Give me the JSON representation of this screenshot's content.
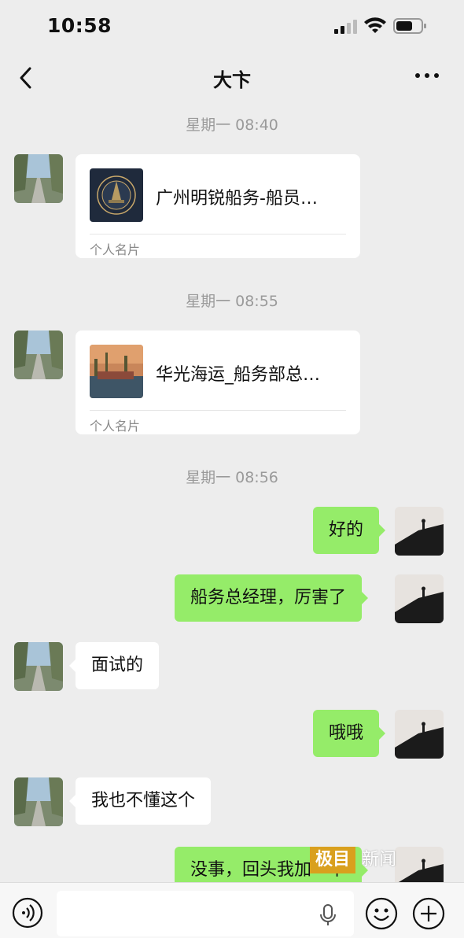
{
  "status_bar": {
    "time": "10:58"
  },
  "chat": {
    "title": "大卞"
  },
  "messages": [
    {
      "type": "time",
      "text": "星期一 08:40"
    },
    {
      "type": "card",
      "side": "left",
      "name": "广州明锐船务-船员…",
      "sub": "个人名片"
    },
    {
      "type": "time",
      "text": "星期一 08:55"
    },
    {
      "type": "card",
      "side": "left",
      "name": "华光海运_船务部总…",
      "sub": "个人名片"
    },
    {
      "type": "time",
      "text": "星期一 08:56"
    },
    {
      "type": "text",
      "side": "right",
      "text": "好的"
    },
    {
      "type": "text",
      "side": "right",
      "text": "船务总经理，厉害了"
    },
    {
      "type": "text",
      "side": "left",
      "text": "面试的"
    },
    {
      "type": "text",
      "side": "right",
      "text": "哦哦"
    },
    {
      "type": "text",
      "side": "left",
      "text": "我也不懂这个"
    },
    {
      "type": "text",
      "side": "right",
      "text": "没事，回头我加一下"
    }
  ],
  "watermark": {
    "part1": "极目",
    "part2": "新闻"
  },
  "colors": {
    "background": "#ededed",
    "self_bubble": "#95ec69",
    "other_bubble": "#ffffff",
    "watermark": "#d9a01e"
  },
  "icons": {
    "back": "chevron-left-icon",
    "more": "more-dots-icon",
    "voice": "voice-icon",
    "mic": "microphone-icon",
    "emoji": "emoji-icon",
    "plus": "plus-icon"
  }
}
